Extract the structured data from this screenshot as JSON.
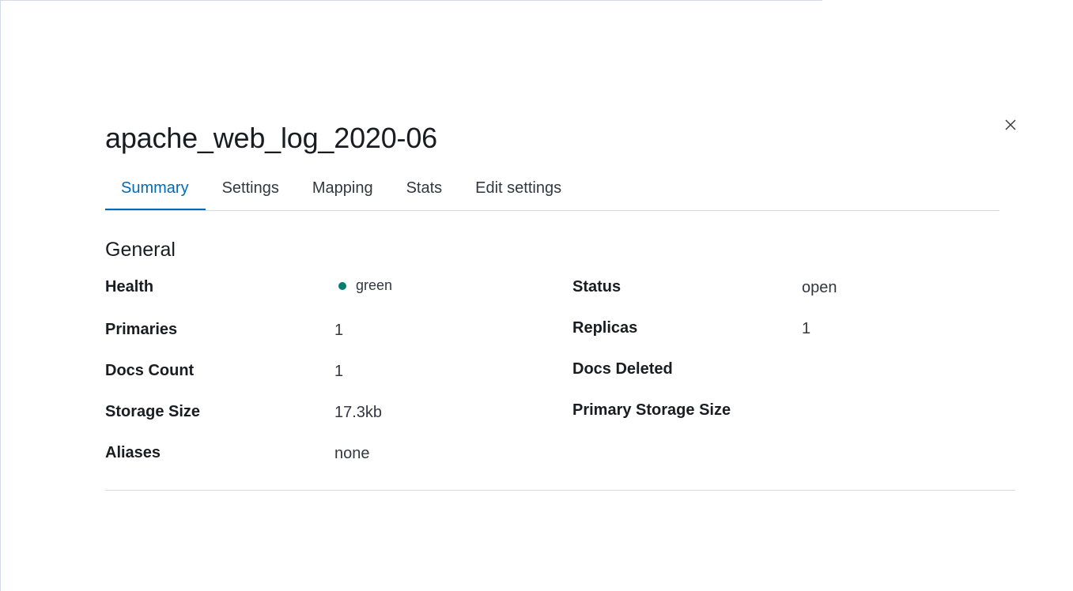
{
  "flyout": {
    "title": "apache_web_log_2020-06",
    "close_icon": "close-icon"
  },
  "tabs": [
    {
      "label": "Summary",
      "selected": true
    },
    {
      "label": "Settings",
      "selected": false
    },
    {
      "label": "Mapping",
      "selected": false
    },
    {
      "label": "Stats",
      "selected": false
    },
    {
      "label": "Edit settings",
      "selected": false
    }
  ],
  "general": {
    "title": "General",
    "health": {
      "label": "Health",
      "value": "green",
      "color": "#017d73"
    },
    "status": {
      "label": "Status",
      "value": "open"
    },
    "primaries": {
      "label": "Primaries",
      "value": "1"
    },
    "replicas": {
      "label": "Replicas",
      "value": "1"
    },
    "docs_count": {
      "label": "Docs Count",
      "value": "1"
    },
    "docs_deleted": {
      "label": "Docs Deleted",
      "value": ""
    },
    "storage_size": {
      "label": "Storage Size",
      "value": "17.3kb"
    },
    "primary_storage_size": {
      "label": "Primary Storage Size",
      "value": ""
    },
    "aliases": {
      "label": "Aliases",
      "value": "none"
    }
  },
  "colors": {
    "accent": "#006bb4",
    "text": "#1a1c21",
    "subdued_text": "#343741",
    "border": "#d3dae6",
    "health_green": "#017d73"
  }
}
